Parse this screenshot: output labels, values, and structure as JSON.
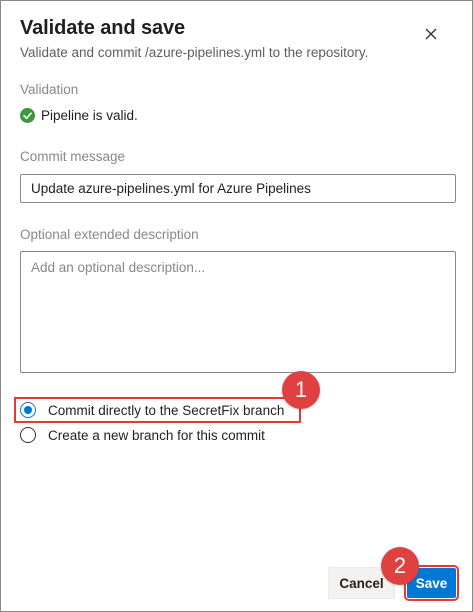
{
  "dialog": {
    "title": "Validate and save",
    "subtitle": "Validate and commit /azure-pipelines.yml to the repository.",
    "close_icon": "close-icon"
  },
  "validation": {
    "label": "Validation",
    "status_text": "Pipeline is valid.",
    "status_icon": "check-circle-icon",
    "status_color": "#3a9a3a"
  },
  "commit_message": {
    "label": "Commit message",
    "value": "Update azure-pipelines.yml for Azure Pipelines"
  },
  "description": {
    "label": "Optional extended description",
    "placeholder": "Add an optional description..."
  },
  "branch_options": [
    {
      "label": "Commit directly to the SecretFix branch",
      "selected": true
    },
    {
      "label": "Create a new branch for this commit",
      "selected": false
    }
  ],
  "annotations": [
    {
      "number": "1"
    },
    {
      "number": "2"
    }
  ],
  "buttons": {
    "cancel_label": "Cancel",
    "save_label": "Save"
  },
  "colors": {
    "accent": "#0078d4",
    "annotation": "#e04040"
  }
}
